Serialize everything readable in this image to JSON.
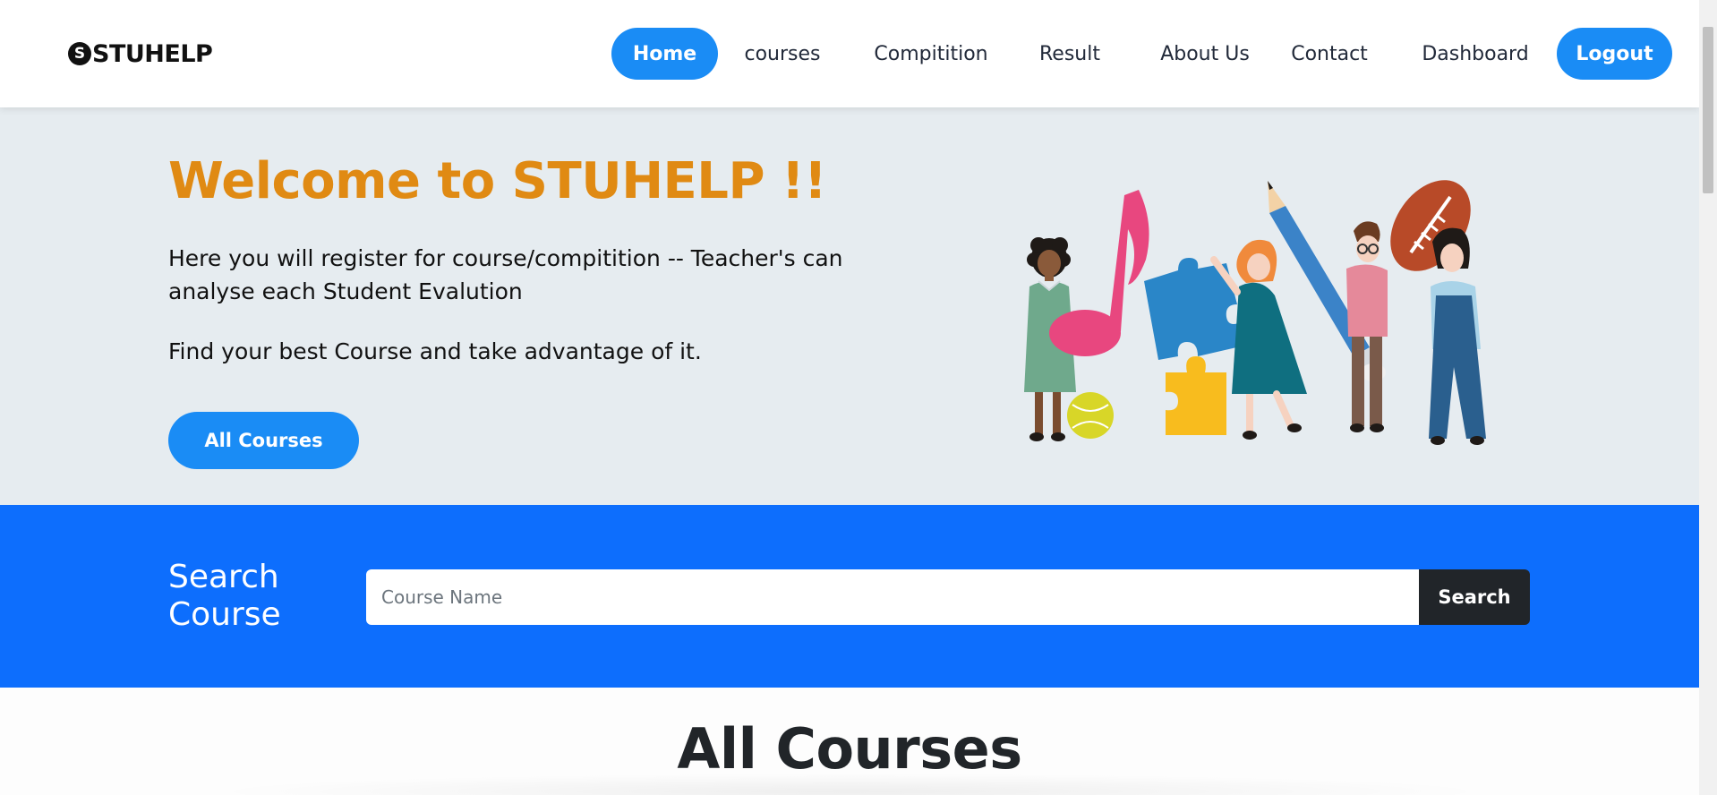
{
  "brand": {
    "icon_letter": "S",
    "name": "STUHELP"
  },
  "nav": {
    "home": "Home",
    "courses": "courses",
    "compitition": "Compitition",
    "result": "Result",
    "about": "About Us",
    "contact": "Contact",
    "dashboard": "Dashboard",
    "logout": "Logout"
  },
  "hero": {
    "title": "Welcome to STUHELP !!",
    "line1": "Here you will register for course/compitition -- Teacher's can analyse each Student Evalution",
    "line2": "Find your best Course and take advantage of it.",
    "button": "All Courses",
    "illustration": "children-with-music-note-puzzle-pencil-football-illustration"
  },
  "search": {
    "label": "Search Course",
    "placeholder": "Course Name",
    "value": "",
    "button": "Search"
  },
  "courses": {
    "title": "All Courses"
  },
  "colors": {
    "accent": "#1a8cf5",
    "search_band": "#0d6efd",
    "hero_bg": "#e6ecf0",
    "title_orange": "#e08a13",
    "dark_button": "#212529"
  }
}
